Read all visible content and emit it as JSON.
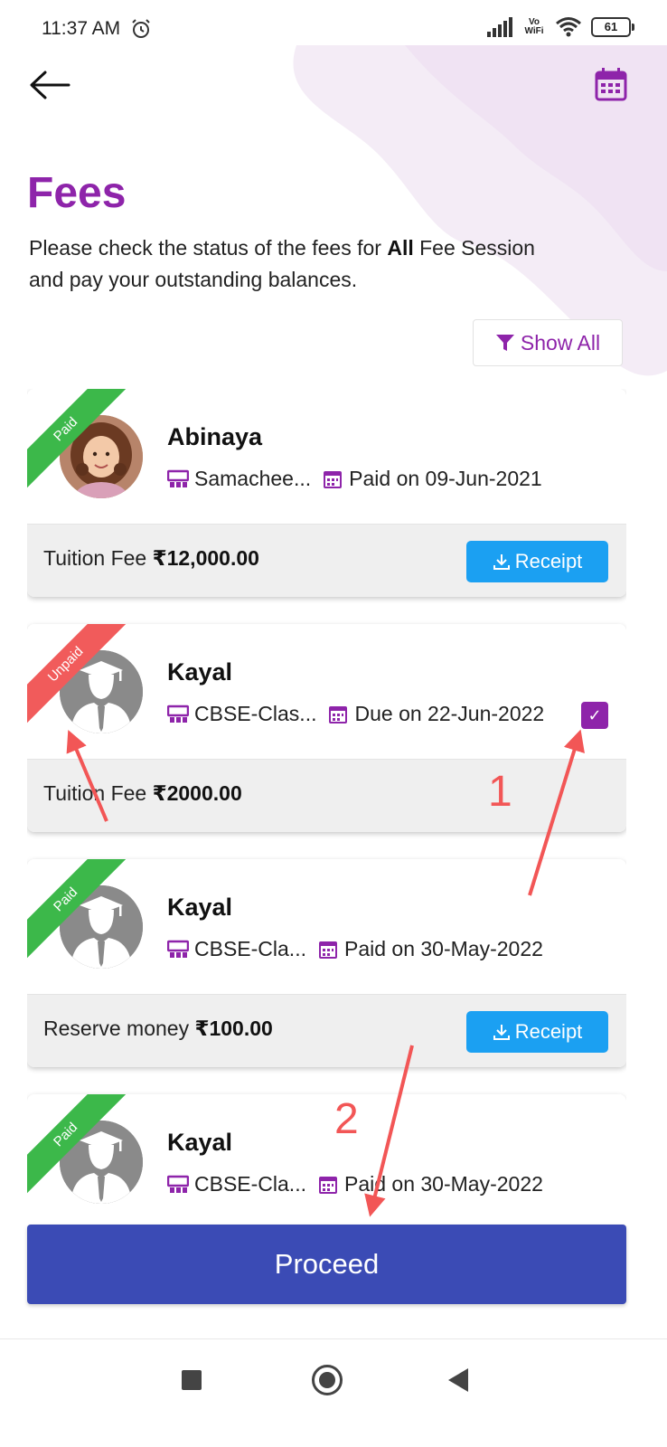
{
  "status_bar": {
    "time": "11:37 AM",
    "network_label_top": "Vo",
    "network_label_bottom": "WiFi",
    "battery": "61"
  },
  "header": {
    "back_icon": "arrow-left-icon",
    "calendar_icon": "calendar-icon",
    "title": "Fees",
    "subtitle_before": "Please check the status of the fees for ",
    "subtitle_bold": "All",
    "subtitle_after": " Fee Session and pay your outstanding balances.",
    "filter_label": "Show All",
    "filter_icon": "filter-icon"
  },
  "fees": [
    {
      "status": "Paid",
      "name": "Abinaya",
      "class": "Samachee...",
      "date_label": "Paid on 09-Jun-2021",
      "fee_type": "Tuition Fee",
      "amount": "₹12,000.00",
      "receipt_label": "Receipt",
      "photo": "girl-photo"
    },
    {
      "status": "Unpaid",
      "name": "Kayal",
      "class": "CBSE-Clas...",
      "date_label": "Due on 22-Jun-2022",
      "fee_type": "Tuition Fee",
      "amount": "₹2000.00",
      "checked": true,
      "check_mark": "✓"
    },
    {
      "status": "Paid",
      "name": "Kayal",
      "class": "CBSE-Cla...",
      "date_label": "Paid on 30-May-2022",
      "fee_type": "Reserve money",
      "amount": "₹100.00",
      "receipt_label": "Receipt"
    },
    {
      "status": "Paid",
      "name": "Kayal",
      "class": "CBSE-Cla...",
      "date_label": "Paid on 30-May-2022"
    }
  ],
  "proceed_label": "Proceed",
  "annotations": {
    "step1": "1",
    "step2": "2",
    "arrow_color": "#f25656"
  },
  "colors": {
    "brand": "#8e24aa",
    "paid": "#3cb84a",
    "unpaid": "#f15b5b",
    "receipt": "#1ba0f2",
    "proceed": "#3b4bb5"
  }
}
